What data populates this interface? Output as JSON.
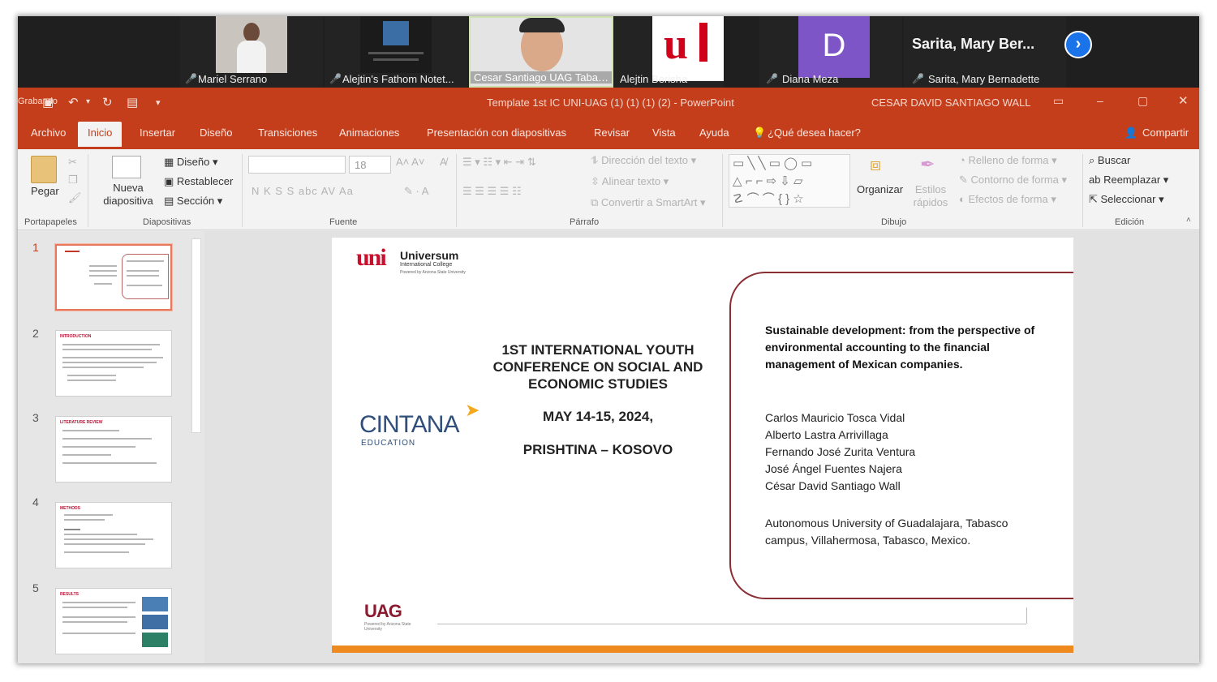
{
  "participants": [
    {
      "name": "Mariel Serrano"
    },
    {
      "name": "Alejtin's Fathom Notet..."
    },
    {
      "name": "Cesar Santiago UAG Tabas..."
    },
    {
      "name": "Alejtin Berisha"
    },
    {
      "name": "Diana Meza",
      "initial": "D"
    },
    {
      "name": "Sarita, Mary Bernadette",
      "display": "Sarita, Mary Ber..."
    }
  ],
  "titlebar": {
    "title": "Template 1st IC UNI-UAG (1) (1) (1) (2)  -  PowerPoint",
    "user": "CESAR DAVID SANTIAGO WALL",
    "recording_label": "Grabando"
  },
  "menu": {
    "tabs": [
      "Archivo",
      "Inicio",
      "Insertar",
      "Diseño",
      "Transiciones",
      "Animaciones",
      "Presentación con diapositivas",
      "Revisar",
      "Vista",
      "Ayuda"
    ],
    "active": "Inicio",
    "tell_me": "¿Qué desea hacer?",
    "share": "Compartir"
  },
  "ribbon": {
    "paste": "Pegar",
    "new_slide": "Nueva diapositiva",
    "layout": "Diseño",
    "reset": "Restablecer",
    "section": "Sección",
    "font_size": "18",
    "font_buttons": "N  K  S  S  abc  AV  Aa",
    "text_direction": "Dirección del texto",
    "align_text": "Alinear texto",
    "smartart": "Convertir a SmartArt",
    "arrange": "Organizar",
    "quick_styles": "Estilos rápidos",
    "shape_fill": "Relleno de forma",
    "shape_outline": "Contorno de forma",
    "shape_effects": "Efectos de forma",
    "find": "Buscar",
    "replace": "Reemplazar",
    "select": "Seleccionar",
    "groups": [
      "Portapapeles",
      "Diapositivas",
      "Fuente",
      "Párrafo",
      "Dibujo",
      "Edición"
    ]
  },
  "thumbnails": [
    {
      "num": "1",
      "title": ""
    },
    {
      "num": "2",
      "title": "INTRODUCTION"
    },
    {
      "num": "3",
      "title": "LITERATURE REVIEW"
    },
    {
      "num": "4",
      "title": "METHODS"
    },
    {
      "num": "5",
      "title": "RESULTS"
    }
  ],
  "slide": {
    "logo_uni_mark": "uni",
    "logo_uni_name": "Universum",
    "logo_uni_sub": "International College",
    "logo_uni_tag": "Powered by Arizona State University",
    "cintana": "CINTANA",
    "cintana_sub": "EDUCATION",
    "uag": "UAG",
    "uag_sub": "Powered by Arizona State University",
    "conf_title": "1ST INTERNATIONAL YOUTH CONFERENCE ON SOCIAL AND ECONOMIC STUDIES",
    "conf_date": "MAY 14-15, 2024,",
    "conf_place": "PRISHTINA – KOSOVO",
    "paper_title": "Sustainable development: from the perspective of environmental accounting to the financial management of Mexican companies.",
    "authors": [
      "Carlos Mauricio Tosca Vidal",
      "Alberto Lastra Arrivillaga",
      "Fernando José Zurita Ventura",
      "José Ángel Fuentes Najera",
      "César David Santiago Wall"
    ],
    "affiliation": "Autonomous University of Guadalajara, Tabasco campus, Villahermosa, Tabasco, Mexico."
  },
  "colors": {
    "ppt_red": "#c43e1c",
    "slide_orange": "#ef8a1e",
    "box_border": "#8a2e35",
    "diana_tile": "#7e55c7",
    "zoom_blue": "#1a73e8"
  }
}
